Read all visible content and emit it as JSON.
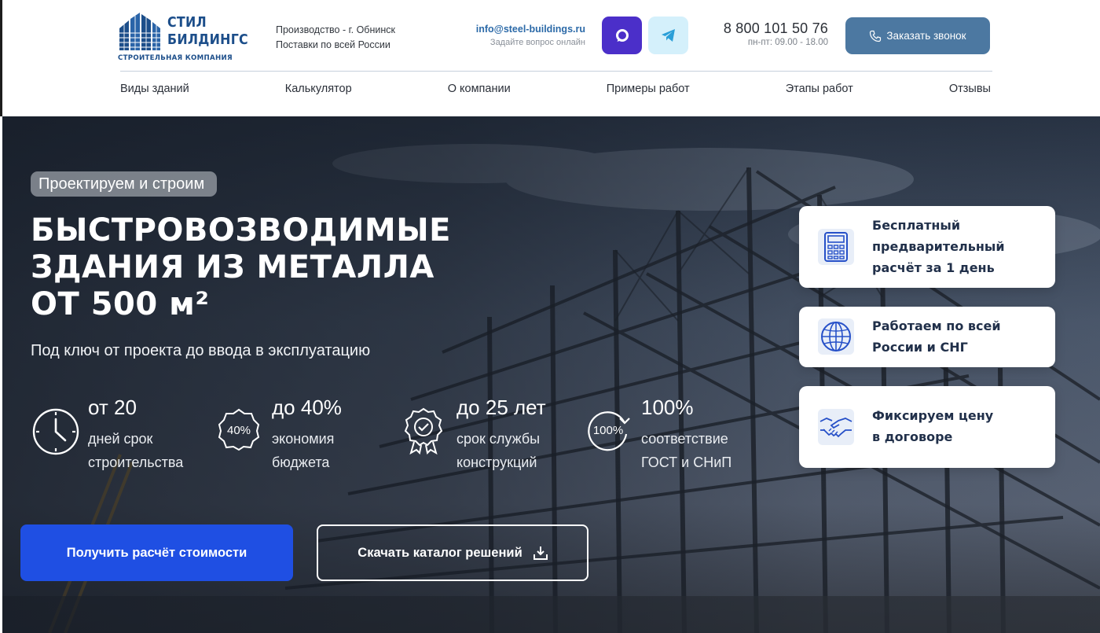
{
  "header": {
    "logo": {
      "line1": "СТИЛ",
      "line2": "БИЛДИНГС",
      "tagline": "СТРОИТЕЛЬНАЯ КОМПАНИЯ"
    },
    "info": {
      "production": "Производство - г. Обнинск",
      "delivery": "Поставки по всей России"
    },
    "contact": {
      "email": "info@steel-buildings.ru",
      "email_note": "Задайте вопрос онлайн"
    },
    "messengers": [
      {
        "icon": "max-messenger-icon",
        "color": "#4b2fc9"
      },
      {
        "icon": "telegram-icon",
        "color": "#d4f0fb"
      }
    ],
    "phone": {
      "number": "8 800 101 50 76",
      "hours": "пн-пт: 09.00 - 18.00"
    },
    "callback_label": "Заказать звонок",
    "accent": "#4c78a1"
  },
  "nav": [
    {
      "label": "Виды зданий"
    },
    {
      "label": "Калькулятор"
    },
    {
      "label": "О компании"
    },
    {
      "label": "Примеры работ"
    },
    {
      "label": "Этапы работ"
    },
    {
      "label": "Отзывы"
    }
  ],
  "hero": {
    "badge": "Проектируем и строим",
    "title_lines": [
      "БЫСТРОВОЗВОДИМЫЕ",
      "ЗДАНИЯ ИЗ МЕТАЛЛА",
      "ОТ 500 м²"
    ],
    "subtitle": "Под ключ от проекта до ввода в эксплуатацию",
    "stats": [
      {
        "icon": "clock-icon",
        "value": "от 20",
        "line1": "дней срок",
        "line2": "строительства"
      },
      {
        "icon": "percent-badge-icon",
        "icon_text": "40%",
        "value": "до 40%",
        "line1": "экономия",
        "line2": "бюджета"
      },
      {
        "icon": "quality-seal-icon",
        "value": "до 25 лет",
        "line1": "срок службы",
        "line2": "конструкций"
      },
      {
        "icon": "cycle-100-icon",
        "icon_text": "100%",
        "value": "100%",
        "line1": "соответствие",
        "line2": "ГОСТ и СНиП"
      }
    ],
    "primary_cta": "Получить расчёт стоимости",
    "secondary_cta": "Скачать каталог решений",
    "primary_color": "#1f4fe3",
    "cards": [
      {
        "icon": "calculator-icon",
        "lines": [
          "Бесплатный",
          "предварительный",
          "расчёт за 1 день"
        ]
      },
      {
        "icon": "globe-icon",
        "lines": [
          "Работаем по всей",
          "России и СНГ"
        ]
      },
      {
        "icon": "handshake-icon",
        "lines": [
          "Фиксируем цену",
          "в договоре"
        ]
      }
    ]
  }
}
